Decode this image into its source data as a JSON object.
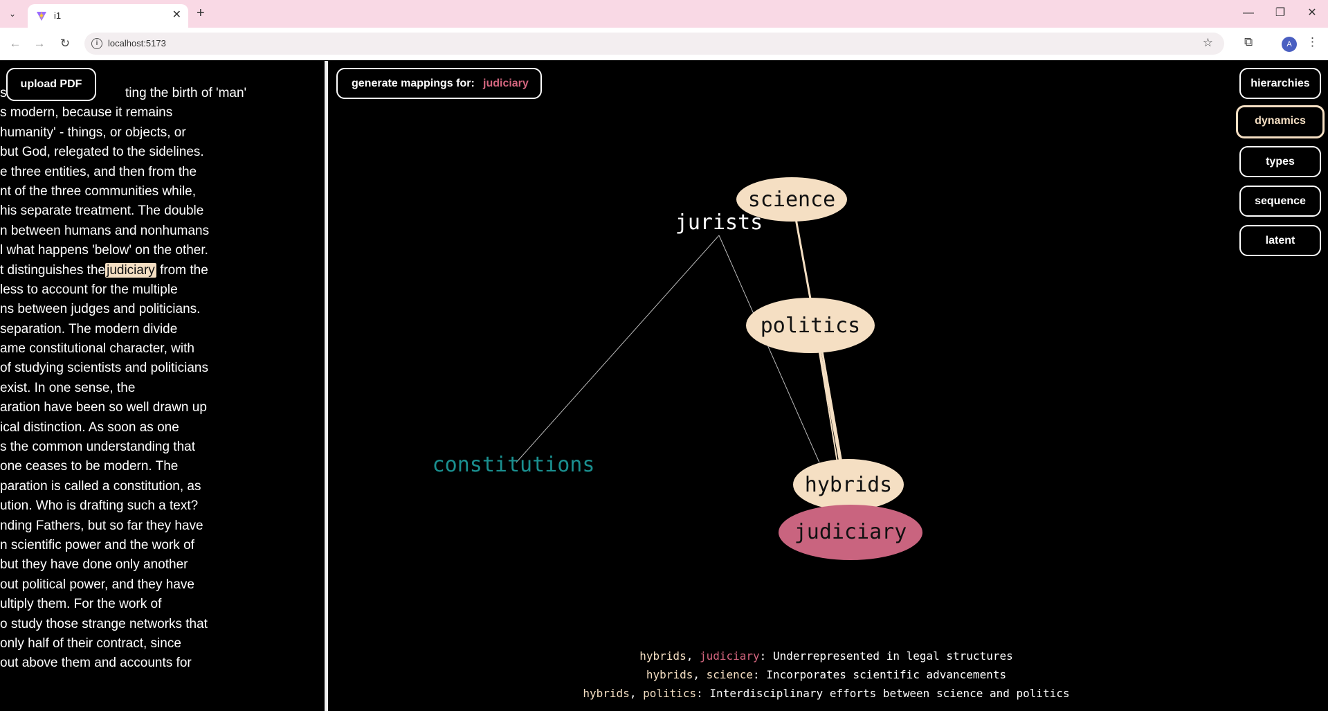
{
  "browser": {
    "tab_title": "i1",
    "url": "localhost:5173",
    "avatar_letter": "A"
  },
  "upload_button": "upload PDF",
  "document_lines": [
    "s",
    "s modern, because it remains",
    "humanity' - things, or objects, or",
    "but God, relegated to the sidelines.",
    "e three entities, and then from the",
    "nt of the three communities while,",
    "his separate treatment. The double",
    "n between humans and nonhumans",
    "l what happens 'below' on the other.",
    "",
    "less to account for the multiple",
    "ns between judges and politicians.",
    " separation. The modern divide",
    "ame constitutional character, with",
    "of studying scientists and politicians",
    " exist. In one sense, the",
    "aration have been so well drawn up",
    "ical distinction. As soon as one",
    "s the common understanding that",
    "one ceases to be modern. The",
    "paration is called a constitution, as",
    "ution. Who is drafting such a text?",
    "nding Fathers, but so far they have",
    "n scientific power and the work of",
    "but they have done only another",
    "out political power, and they have",
    "ultiply them. For the work of",
    "o study those strange networks that",
    " only half of their contract, since",
    "out above them and accounts for"
  ],
  "first_line_tail": "ting the birth of 'man'",
  "highlight_line": {
    "before": "t distinguishes the",
    "term": "judiciary",
    "after": " from the"
  },
  "generate": {
    "label": "generate mappings for:",
    "term": "judiciary"
  },
  "modes": [
    {
      "label": "hierarchies",
      "selected": false
    },
    {
      "label": "dynamics",
      "selected": true
    },
    {
      "label": "types",
      "selected": false
    },
    {
      "label": "sequence",
      "selected": false
    },
    {
      "label": "latent",
      "selected": false
    }
  ],
  "graph": {
    "nodes": {
      "science": "science",
      "jurists": "jurists",
      "politics": "politics",
      "constitutions": "constitutions",
      "hybrids": "hybrids",
      "judiciary": "judiciary"
    },
    "colors": {
      "node_fill": "#f5dfc3",
      "focus_fill": "#c9647f",
      "constitutions_text": "#1a8f8f",
      "edge": "#f5dfc3"
    }
  },
  "relations": [
    {
      "a": "hybrids",
      "b": "judiciary",
      "b_color": "pink",
      "desc": "Underrepresented in legal structures"
    },
    {
      "a": "hybrids",
      "b": "science",
      "b_color": "cream",
      "desc": "Incorporates scientific advancements"
    },
    {
      "a": "hybrids",
      "b": "politics",
      "b_color": "cream",
      "desc": "Interdisciplinary efforts between science and politics"
    }
  ]
}
